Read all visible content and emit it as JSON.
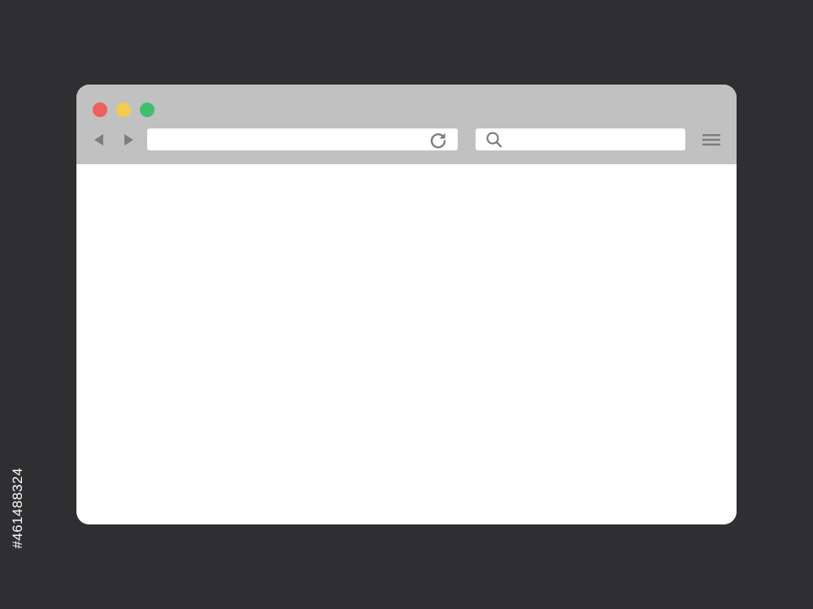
{
  "window_controls": {
    "close_color": "#f05f5f",
    "minimize_color": "#f3cc4f",
    "maximize_color": "#3fbf6e"
  },
  "toolbar": {
    "background": "#c1c1c1",
    "icon_color": "#7d7d7d",
    "back_icon": "triangle-left",
    "forward_icon": "triangle-right",
    "reload_icon": "reload",
    "search_icon": "magnifier",
    "menu_icon": "hamburger"
  },
  "address_bar": {
    "value": "",
    "placeholder": ""
  },
  "search_box": {
    "value": "",
    "placeholder": ""
  },
  "page": {
    "background": "#2f2f31",
    "content_background": "#ffffff"
  },
  "watermark": {
    "stock_id": "#461488324"
  }
}
